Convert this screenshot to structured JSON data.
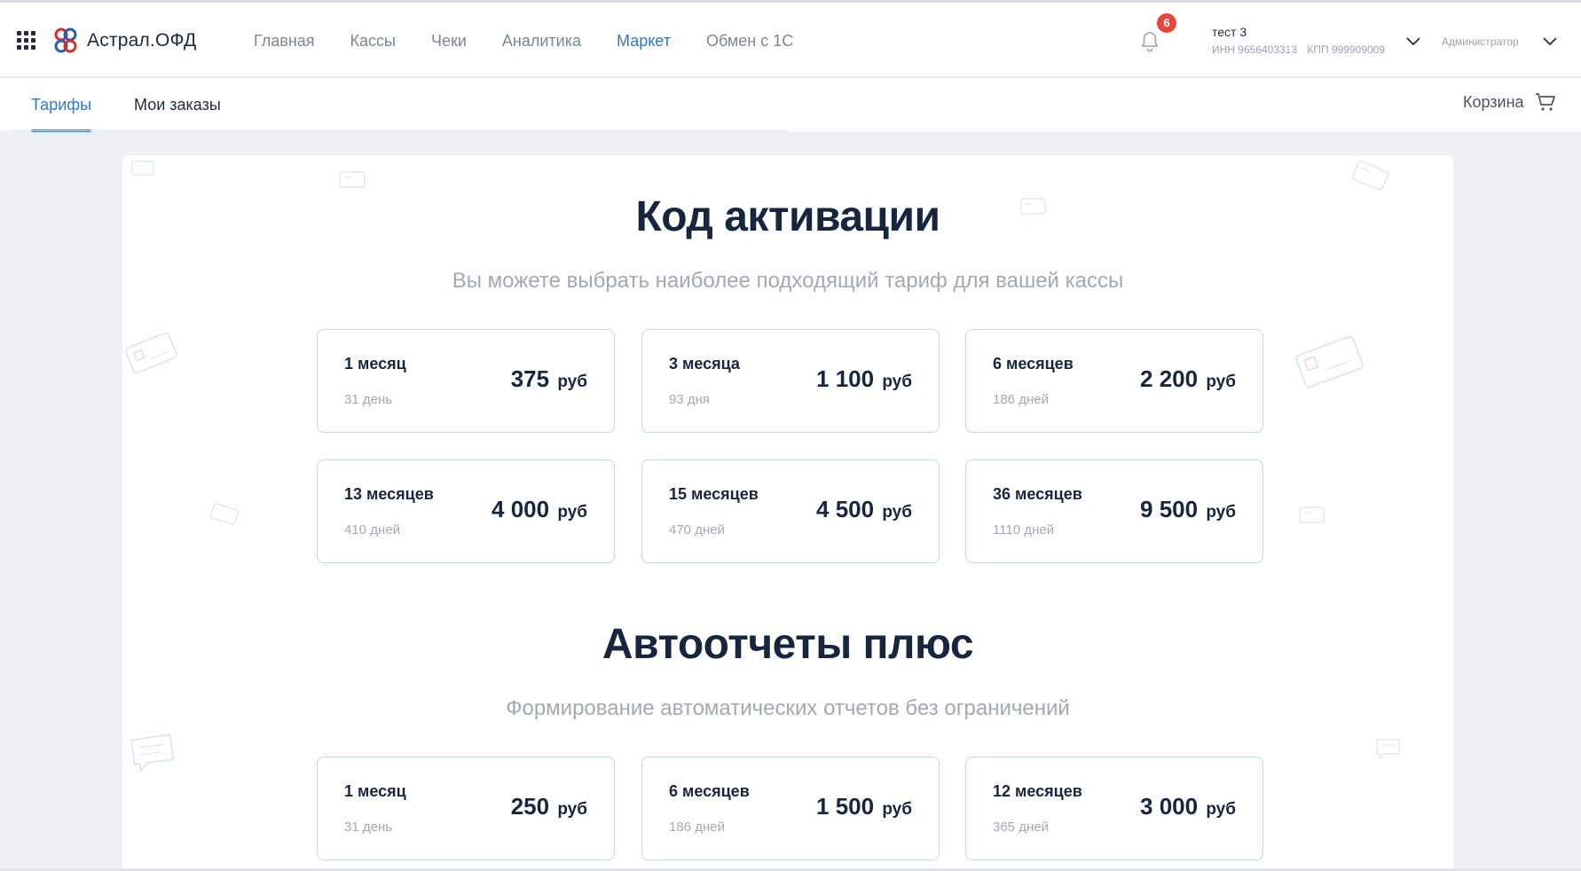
{
  "brand": {
    "name": "Астрал.ОФД"
  },
  "nav": {
    "items": [
      {
        "label": "Главная",
        "active": false
      },
      {
        "label": "Кассы",
        "active": false
      },
      {
        "label": "Чеки",
        "active": false
      },
      {
        "label": "Аналитика",
        "active": false
      },
      {
        "label": "Маркет",
        "active": true
      },
      {
        "label": "Обмен с 1С",
        "active": false
      }
    ]
  },
  "notifications": {
    "count": "6",
    "icon": "bell-icon"
  },
  "organization": {
    "name": "тест 3",
    "inn": "ИНН 9656403313",
    "kpp": "КПП 999909009"
  },
  "user": {
    "role": "Администратор"
  },
  "subnav": {
    "tabs": [
      {
        "label": "Тарифы",
        "active": true
      },
      {
        "label": "Мои заказы",
        "active": false
      }
    ],
    "cart_label": "Корзина"
  },
  "colors": {
    "accent": "#2b78d0",
    "badge": "#e8453c",
    "title": "#17263f",
    "card_border": "#bfd6ee"
  },
  "sections": [
    {
      "title": "Код активации",
      "subtitle": "Вы можете выбрать наиболее подходящий тариф для вашей кассы",
      "cards": [
        {
          "period": "1 месяц",
          "days": "31 день",
          "price": "375",
          "currency": "руб"
        },
        {
          "period": "3 месяца",
          "days": "93 дня",
          "price": "1 100",
          "currency": "руб"
        },
        {
          "period": "6 месяцев",
          "days": "186 дней",
          "price": "2 200",
          "currency": "руб"
        },
        {
          "period": "13 месяцев",
          "days": "410 дней",
          "price": "4 000",
          "currency": "руб"
        },
        {
          "period": "15 месяцев",
          "days": "470 дней",
          "price": "4 500",
          "currency": "руб"
        },
        {
          "period": "36 месяцев",
          "days": "1110 дней",
          "price": "9 500",
          "currency": "руб"
        }
      ]
    },
    {
      "title": "Автоотчеты плюс",
      "subtitle": "Формирование автоматических отчетов без ограничений",
      "cards": [
        {
          "period": "1 месяц",
          "days": "31 день",
          "price": "250",
          "currency": "руб"
        },
        {
          "period": "6 месяцев",
          "days": "186 дней",
          "price": "1 500",
          "currency": "руб"
        },
        {
          "period": "12 месяцев",
          "days": "365 дней",
          "price": "3 000",
          "currency": "руб"
        }
      ]
    }
  ]
}
